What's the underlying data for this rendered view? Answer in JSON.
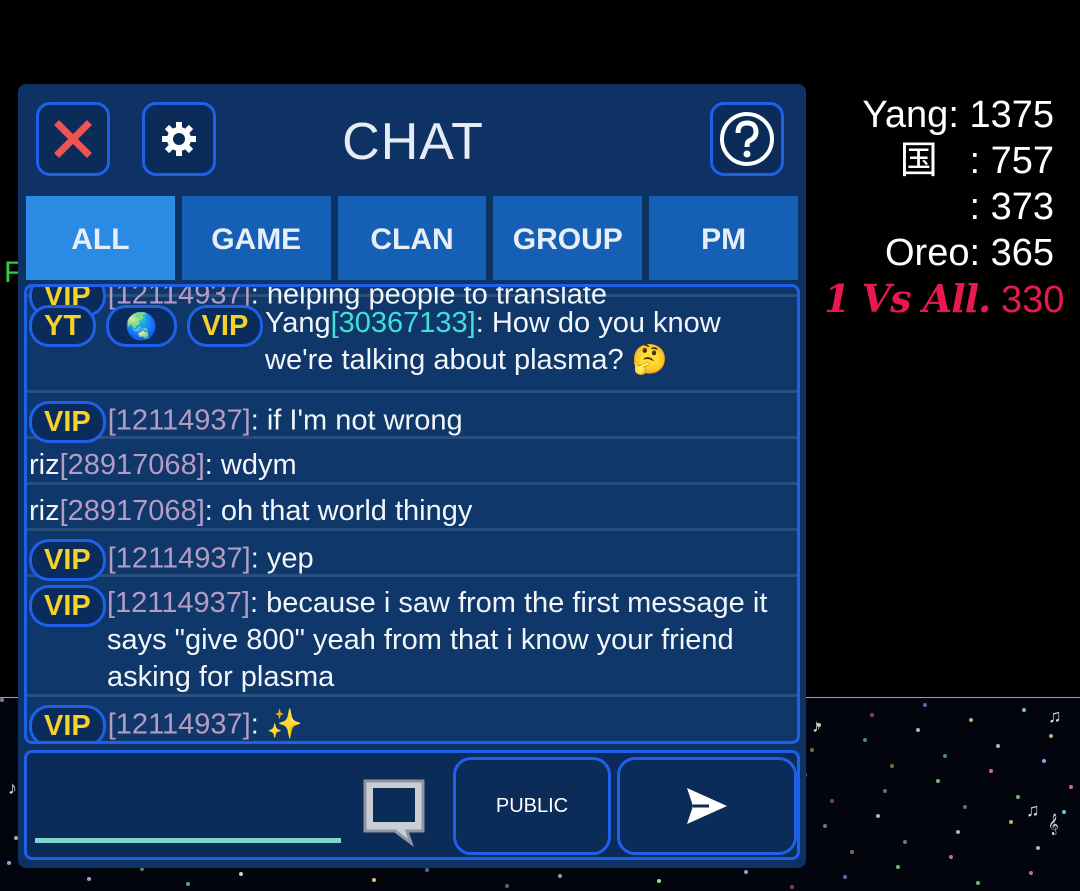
{
  "leaderboard": [
    {
      "name": "Yang",
      "score": "1375"
    },
    {
      "name": "国",
      "score": "757"
    },
    {
      "name": "",
      "score": "373"
    },
    {
      "name": "Oreo",
      "score": "365"
    },
    {
      "name": "1 Vs All.",
      "score": "330"
    }
  ],
  "chat": {
    "title": "CHAT",
    "close_icon": "close-icon",
    "settings_icon": "gear-icon",
    "help_icon": "help-icon",
    "tabs": [
      {
        "label": "ALL",
        "active": true
      },
      {
        "label": "GAME"
      },
      {
        "label": "CLAN"
      },
      {
        "label": "GROUP"
      },
      {
        "label": "PM"
      }
    ],
    "messages": [
      {
        "badges": [
          "VIP"
        ],
        "id": "[12114937]",
        "text": ": helping people to translate"
      },
      {
        "badges": [
          "YT",
          "globe",
          "VIP"
        ],
        "name": "Yang",
        "id": "[30367133]",
        "text": ": How do you know we're talking about plasma? 🤔"
      },
      {
        "badges": [
          "VIP"
        ],
        "id": "[12114937]",
        "text": ": if I'm not wrong"
      },
      {
        "name": "riz",
        "id": "[28917068]",
        "text": ": wdym"
      },
      {
        "name": "riz",
        "id": "[28917068]",
        "text": ": oh that world thingy"
      },
      {
        "badges": [
          "VIP"
        ],
        "id": "[12114937]",
        "text": ": yep"
      },
      {
        "badges": [
          "VIP"
        ],
        "id": "[12114937]",
        "text": ": because i saw from the first message it says \"give 800\" yeah from that i know your friend asking for plasma"
      },
      {
        "badges": [
          "VIP"
        ],
        "id": "[12114937]",
        "text": ": ✨"
      }
    ],
    "input": {
      "value": "",
      "placeholder": ""
    },
    "public_label": "PUBLIC",
    "send_icon": "send-icon",
    "emoji_icon": "chat-bubble-icon"
  },
  "colors": {
    "panel": "#0d3263",
    "border": "#1e60e8",
    "tab": "#1560b4",
    "tab_active": "#2a8ae4",
    "vip": "#f5d22a",
    "special": "#e8194f"
  }
}
